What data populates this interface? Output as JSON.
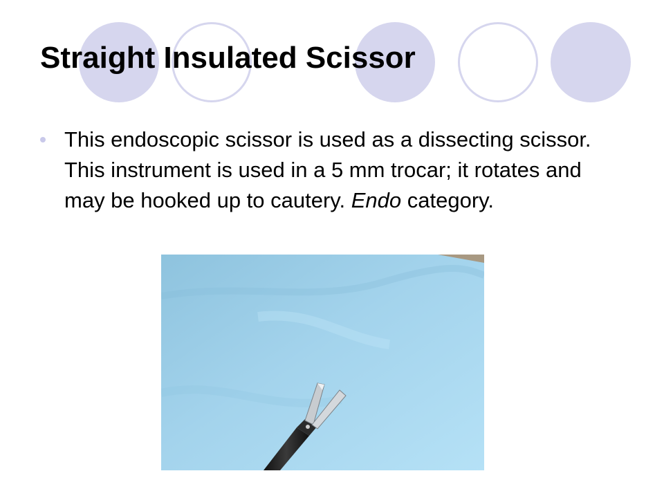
{
  "slide": {
    "title": "Straight Insulated Scissor",
    "bullet": {
      "text_before": "This endoscopic scissor is used as a dissecting scissor. This instrument is used in a 5 mm trocar; it rotates and may be hooked up to cautery.  ",
      "emphasis": "Endo",
      "text_after": " category."
    }
  },
  "colors": {
    "decor_circle": "#d6d6ee",
    "bullet": "#c9c9ea",
    "photo_background": "#9fd0ec"
  },
  "icons": {
    "bullet": "bullet-dot-icon"
  }
}
